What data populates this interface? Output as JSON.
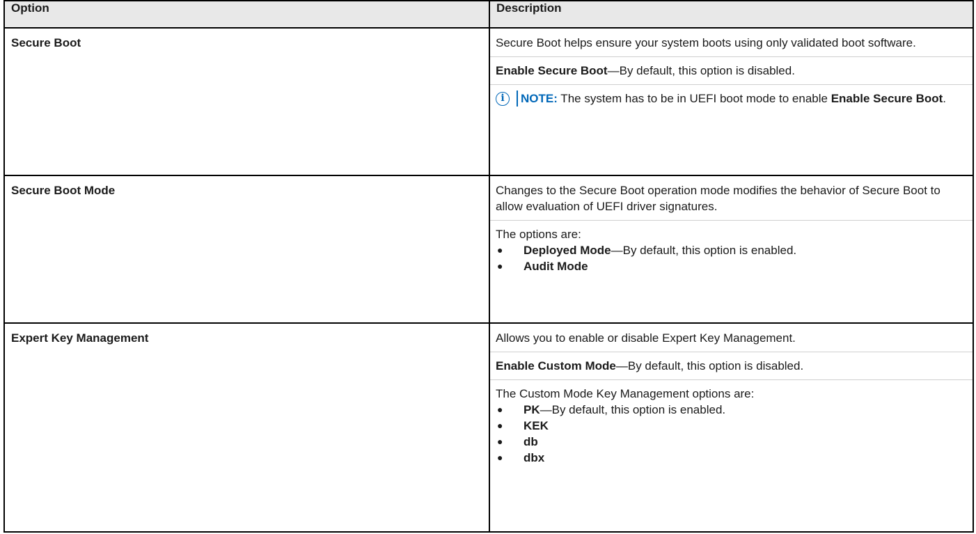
{
  "header": {
    "option": "Option",
    "description": "Description"
  },
  "rows": [
    {
      "option": "Secure Boot",
      "desc": {
        "p1": "Secure Boot helps ensure your system boots using only validated boot software.",
        "enable_bold": "Enable Secure Boot",
        "enable_rest": "—By default, this option is disabled.",
        "note_label": "NOTE:",
        "note_text": " The system has to be in UEFI boot mode to enable ",
        "note_bold": "Enable Secure Boot",
        "note_end": "."
      }
    },
    {
      "option": "Secure Boot Mode",
      "desc": {
        "p1": "Changes to the Secure Boot operation mode modifies the behavior of Secure Boot to allow evaluation of UEFI driver signatures.",
        "list_intro": "The options are:",
        "items": [
          {
            "bold": "Deployed Mode",
            "rest": "—By default, this option is enabled."
          },
          {
            "bold": "Audit Mode",
            "rest": ""
          }
        ]
      }
    },
    {
      "option": "Expert Key Management",
      "desc": {
        "p1": "Allows you to enable or disable Expert Key Management.",
        "enable_bold": "Enable Custom Mode",
        "enable_rest": "—By default, this option is disabled.",
        "list_intro": "The Custom Mode Key Management options are:",
        "items": [
          {
            "bold": "PK",
            "rest": "—By default, this option is enabled."
          },
          {
            "bold": "KEK",
            "rest": ""
          },
          {
            "bold": "db",
            "rest": ""
          },
          {
            "bold": "dbx",
            "rest": ""
          }
        ]
      }
    }
  ],
  "colors": {
    "note_accent": "#0067b8",
    "header_bg": "#e8e8e8"
  },
  "icons": {
    "note": "info-circle-icon",
    "bullet": "bullet-icon"
  }
}
